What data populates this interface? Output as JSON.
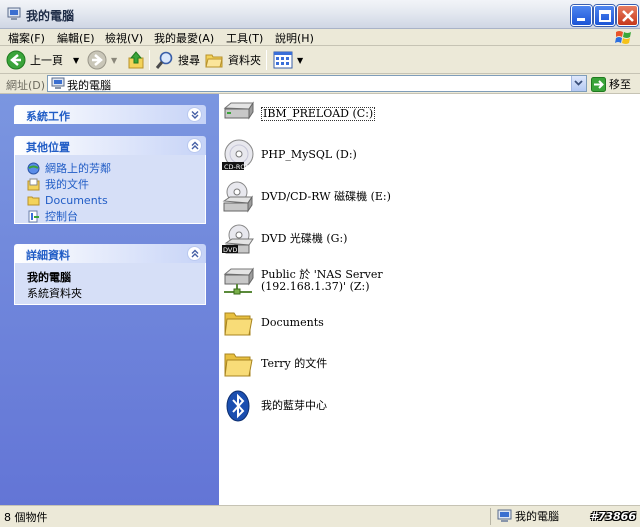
{
  "window": {
    "title": "我的電腦"
  },
  "menu": [
    "檔案(F)",
    "編輯(E)",
    "檢視(V)",
    "我的最愛(A)",
    "工具(T)",
    "說明(H)"
  ],
  "toolbar": {
    "back_label": "上一頁",
    "search_label": "搜尋",
    "folders_label": "資料夾"
  },
  "address": {
    "label": "網址(D)",
    "value": "我的電腦",
    "go_label": "移至"
  },
  "left_panel": {
    "system_tasks": {
      "title": "系統工作"
    },
    "other_places": {
      "title": "其他位置",
      "links": [
        "網路上的芳鄰",
        "我的文件",
        "Documents",
        "控制台"
      ]
    },
    "details": {
      "title": "詳細資料",
      "name": "我的電腦",
      "type": "系統資料夾"
    }
  },
  "items": [
    {
      "label": "IBM_PRELOAD (C:)",
      "icon": "hard-drive-icon"
    },
    {
      "label": "PHP_MySQL (D:)",
      "icon": "cdrom-icon"
    },
    {
      "label": "DVD/CD-RW 磁碟機 (E:)",
      "icon": "dvd-rw-drive-icon"
    },
    {
      "label": "DVD 光碟機 (G:)",
      "icon": "dvd-drive-icon"
    },
    {
      "label": "Public 於 'NAS Server",
      "label2": "(192.168.1.37)' (Z:)",
      "icon": "network-drive-icon"
    },
    {
      "label": "Documents",
      "icon": "folder-icon"
    },
    {
      "label": "Terry 的文件",
      "icon": "folder-icon"
    },
    {
      "label": "我的藍芽中心",
      "icon": "bluetooth-icon"
    }
  ],
  "status": {
    "count": "8 個物件",
    "location": "我的電腦",
    "watermark": "#73866"
  }
}
